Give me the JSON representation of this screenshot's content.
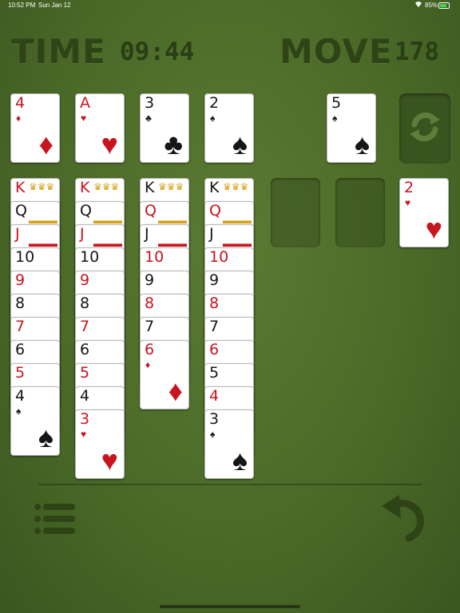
{
  "status_bar": {
    "time": "10:52 PM",
    "date": "Sun Jan 12",
    "battery": "85%",
    "battery_level": 0.85
  },
  "header": {
    "time_label": "TIME",
    "time_value": "09:44",
    "move_label": "MOVE",
    "move_value": "178"
  },
  "foundations": [
    {
      "rank": "4",
      "suit": "♦",
      "color": "red"
    },
    {
      "rank": "A",
      "suit": "♥",
      "color": "red"
    },
    {
      "rank": "3",
      "suit": "♣",
      "color": "black"
    },
    {
      "rank": "2",
      "suit": "♠",
      "color": "black"
    }
  ],
  "waste": {
    "rank": "5",
    "suit": "♠",
    "color": "black"
  },
  "free_card": {
    "rank": "2",
    "suit": "♥",
    "color": "red"
  },
  "tableau": [
    [
      {
        "rank": "K",
        "suit": "",
        "color": "red",
        "face": true
      },
      {
        "rank": "Q",
        "suit": "",
        "color": "black",
        "face": true
      },
      {
        "rank": "J",
        "suit": "",
        "color": "red",
        "face": true
      },
      {
        "rank": "10",
        "suit": "",
        "color": "black"
      },
      {
        "rank": "9",
        "suit": "",
        "color": "red"
      },
      {
        "rank": "8",
        "suit": "",
        "color": "black"
      },
      {
        "rank": "7",
        "suit": "",
        "color": "red"
      },
      {
        "rank": "6",
        "suit": "",
        "color": "black"
      },
      {
        "rank": "5",
        "suit": "",
        "color": "red"
      },
      {
        "rank": "4",
        "suit": "♠",
        "color": "black"
      }
    ],
    [
      {
        "rank": "K",
        "suit": "",
        "color": "red",
        "face": true
      },
      {
        "rank": "Q",
        "suit": "",
        "color": "black",
        "face": true
      },
      {
        "rank": "J",
        "suit": "",
        "color": "red",
        "face": true
      },
      {
        "rank": "10",
        "suit": "",
        "color": "black"
      },
      {
        "rank": "9",
        "suit": "",
        "color": "red"
      },
      {
        "rank": "8",
        "suit": "",
        "color": "black"
      },
      {
        "rank": "7",
        "suit": "",
        "color": "red"
      },
      {
        "rank": "6",
        "suit": "",
        "color": "black"
      },
      {
        "rank": "5",
        "suit": "",
        "color": "red"
      },
      {
        "rank": "4",
        "suit": "",
        "color": "black"
      },
      {
        "rank": "3",
        "suit": "♥",
        "color": "red"
      }
    ],
    [
      {
        "rank": "K",
        "suit": "",
        "color": "black",
        "face": true
      },
      {
        "rank": "Q",
        "suit": "",
        "color": "red",
        "face": true
      },
      {
        "rank": "J",
        "suit": "",
        "color": "black",
        "face": true
      },
      {
        "rank": "10",
        "suit": "",
        "color": "red"
      },
      {
        "rank": "9",
        "suit": "",
        "color": "black"
      },
      {
        "rank": "8",
        "suit": "",
        "color": "red"
      },
      {
        "rank": "7",
        "suit": "",
        "color": "black"
      },
      {
        "rank": "6",
        "suit": "♦",
        "color": "red"
      }
    ],
    [
      {
        "rank": "K",
        "suit": "",
        "color": "black",
        "face": true
      },
      {
        "rank": "Q",
        "suit": "",
        "color": "red",
        "face": true
      },
      {
        "rank": "J",
        "suit": "",
        "color": "black",
        "face": true
      },
      {
        "rank": "10",
        "suit": "",
        "color": "red"
      },
      {
        "rank": "9",
        "suit": "",
        "color": "black"
      },
      {
        "rank": "8",
        "suit": "",
        "color": "red"
      },
      {
        "rank": "7",
        "suit": "",
        "color": "black"
      },
      {
        "rank": "6",
        "suit": "",
        "color": "red"
      },
      {
        "rank": "5",
        "suit": "",
        "color": "black"
      },
      {
        "rank": "4",
        "suit": "",
        "color": "red"
      },
      {
        "rank": "3",
        "suit": "♠",
        "color": "black"
      }
    ]
  ],
  "colors": {
    "felt": "#4b6a28",
    "red_suit": "#c8141e",
    "black_suit": "#161616",
    "header_text": "#2f4416"
  },
  "icons": {
    "recycle": "recycle-icon",
    "menu": "menu-list-icon",
    "undo": "undo-icon"
  }
}
